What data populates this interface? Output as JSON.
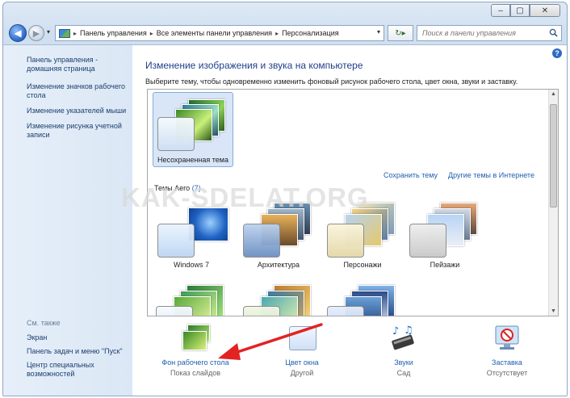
{
  "address": {
    "crumbs": [
      "Панель управления",
      "Все элементы панели управления",
      "Персонализация"
    ]
  },
  "search": {
    "placeholder": "Поиск в панели управления"
  },
  "sidebar": {
    "items": [
      "Панель управления - домашняя страница",
      "Изменение значков рабочего стола",
      "Изменение указателей мыши",
      "Изменение рисунка учетной записи"
    ],
    "see_also_title": "См. также",
    "see_also": [
      "Экран",
      "Панель задач и меню \"Пуск\"",
      "Центр специальных возможностей"
    ]
  },
  "main": {
    "title": "Изменение изображения и звука на компьютере",
    "subtitle": "Выберите тему, чтобы одновременно изменить фоновый рисунок рабочего стола, цвет окна, звуки и заставку.",
    "unsaved_theme": "Несохраненная тема",
    "save_theme": "Сохранить тему",
    "more_themes": "Другие темы в Интернете",
    "aero_group": "Темы Aero",
    "aero_count": "(7)",
    "themes": [
      "Windows 7",
      "Архитектура",
      "Персонажи",
      "Пейзажи"
    ]
  },
  "bottom": {
    "items": [
      {
        "label": "Фон рабочего стола",
        "value": "Показ слайдов"
      },
      {
        "label": "Цвет окна",
        "value": "Другой"
      },
      {
        "label": "Звуки",
        "value": "Сад"
      },
      {
        "label": "Заставка",
        "value": "Отсутствует"
      }
    ]
  },
  "watermark": "KAK-SDELAT.ORG",
  "colors": {
    "link": "#1f5fb0",
    "title": "#1f3f8a",
    "arrow": "#e32222",
    "sidebar": "#dbe7f5"
  }
}
